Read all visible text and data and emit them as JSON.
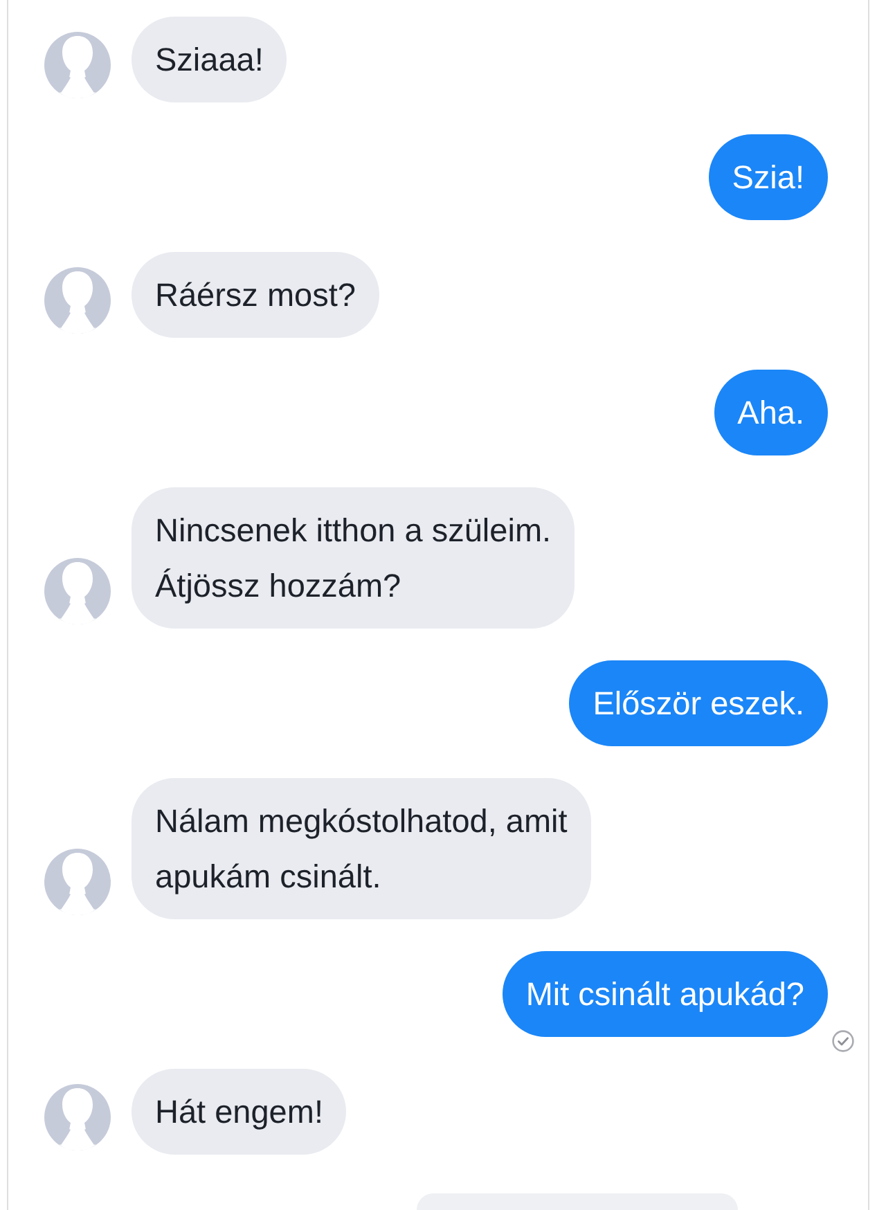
{
  "messages": [
    {
      "kind": "incoming",
      "text": "Sziaaa!",
      "seen": false
    },
    {
      "kind": "outgoing",
      "text": "Szia!",
      "seen": false
    },
    {
      "kind": "incoming",
      "text": "Ráérsz most?",
      "seen": false
    },
    {
      "kind": "outgoing",
      "text": "Aha.",
      "seen": false
    },
    {
      "kind": "incoming",
      "text": "Nincsenek itthon a szüleim.\nÁtjössz hozzám?",
      "seen": false
    },
    {
      "kind": "outgoing",
      "text": "Először eszek.",
      "seen": false
    },
    {
      "kind": "incoming",
      "text": "Nálam megkóstolhatod, amit\napukám csinált.",
      "seen": false
    },
    {
      "kind": "outgoing",
      "text": "Mit csinált apukád?",
      "seen": true
    },
    {
      "kind": "incoming",
      "text": "Hát engem!",
      "seen": false
    },
    {
      "kind": "partial"
    }
  ]
}
